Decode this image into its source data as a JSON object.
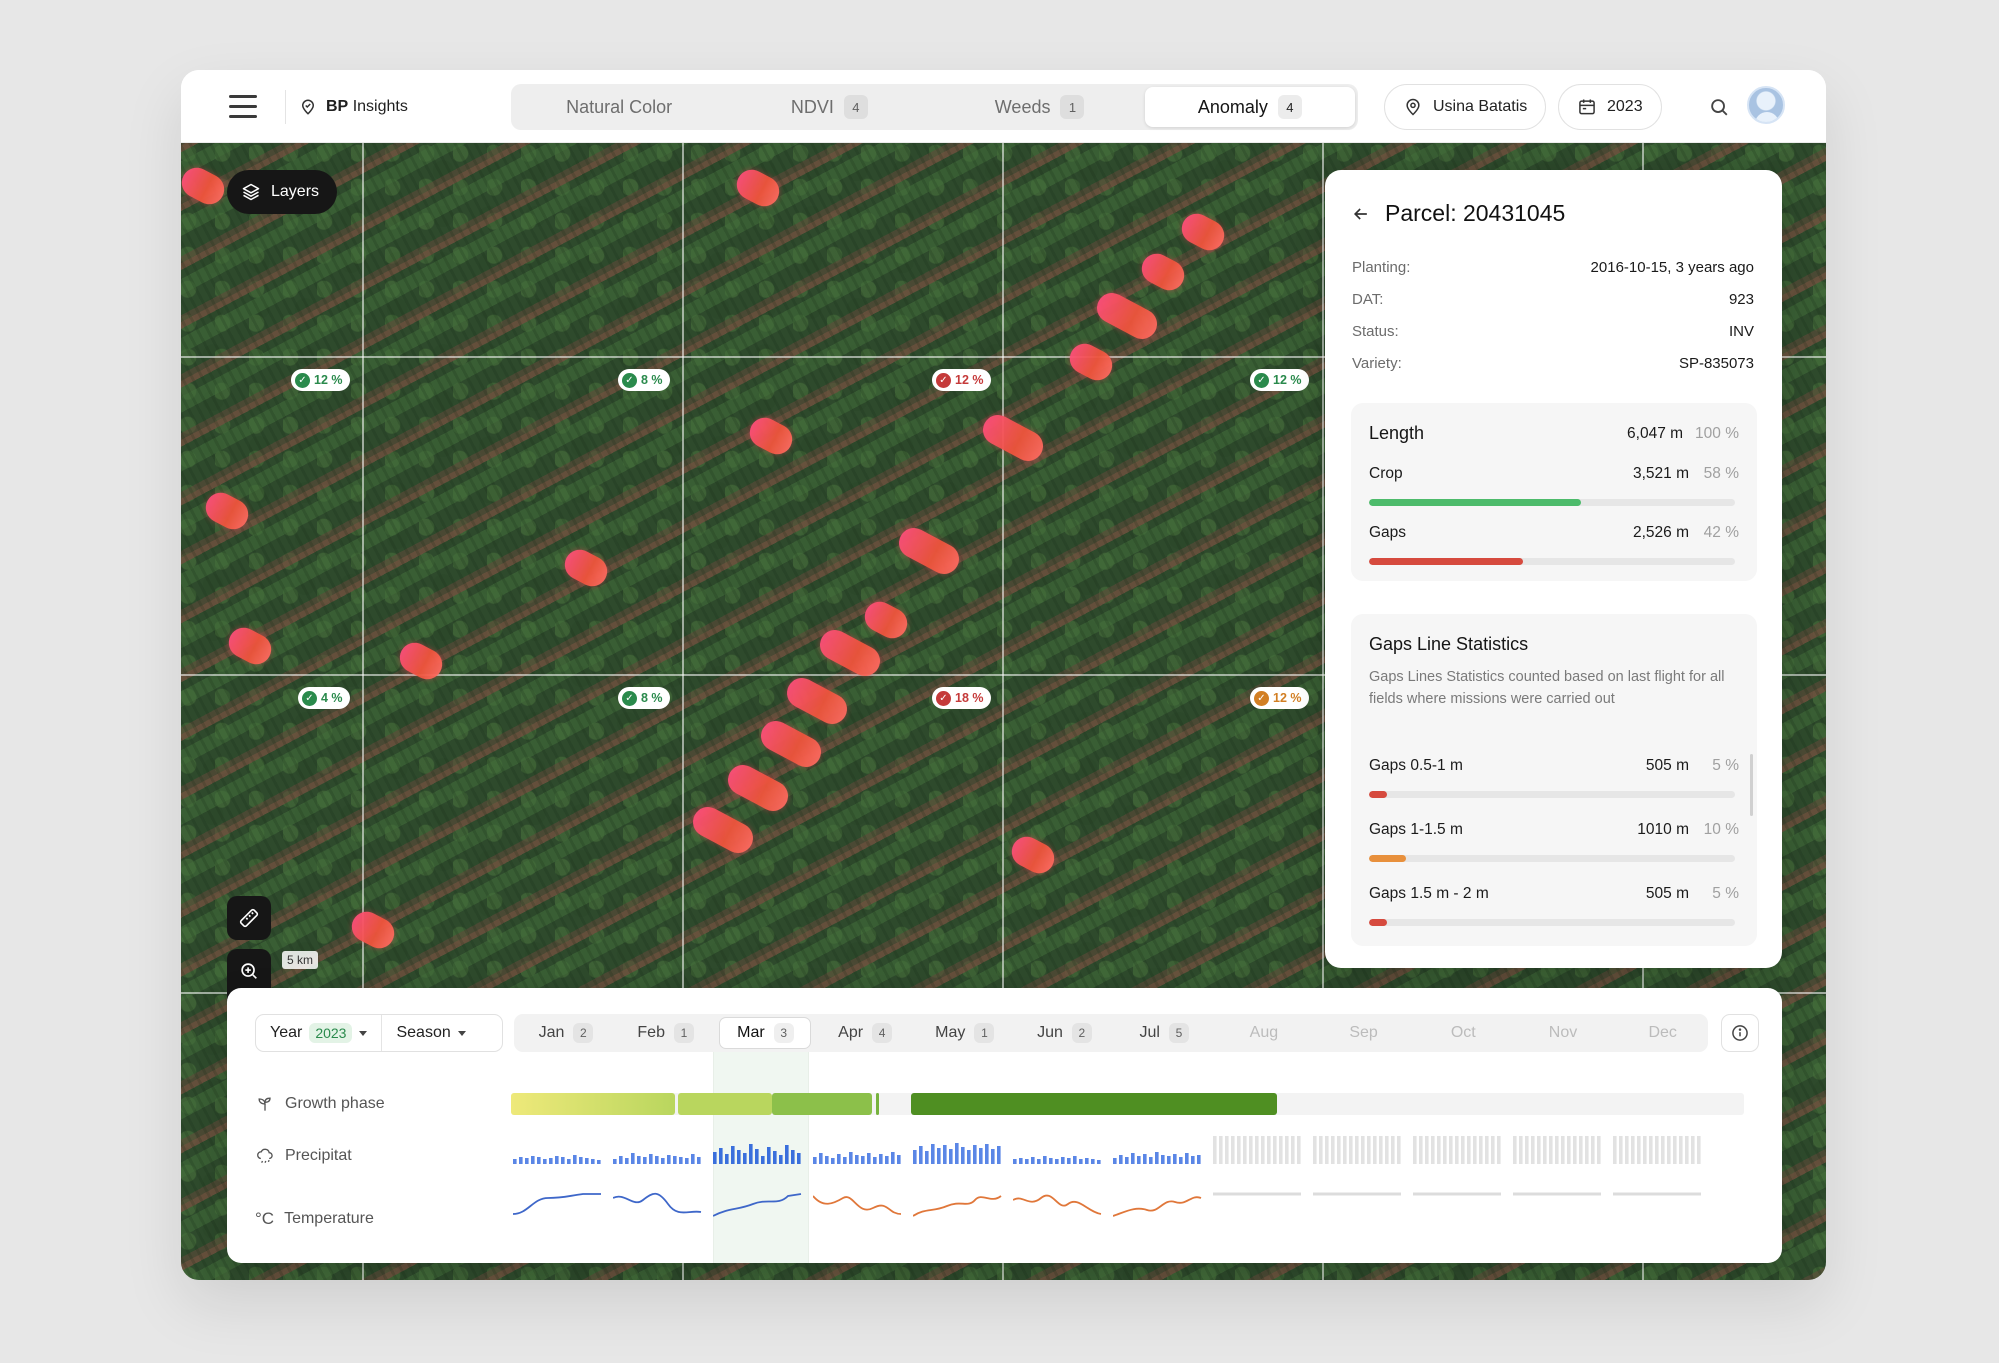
{
  "brand": {
    "name_bold": "BP",
    "name": "Insights"
  },
  "tabs": [
    {
      "label": "Natural Color",
      "count": ""
    },
    {
      "label": "NDVI",
      "count": "4"
    },
    {
      "label": "Weeds",
      "count": "1"
    },
    {
      "label": "Anomaly",
      "count": "4"
    }
  ],
  "active_tab": "Anomaly",
  "location": "Usina Batatis",
  "year_picker": "2023",
  "map": {
    "layers_label": "Layers",
    "scale_label": "5 km",
    "badges": [
      {
        "value": "12 %",
        "status": "green"
      },
      {
        "value": "8 %",
        "status": "green"
      },
      {
        "value": "12 %",
        "status": "red"
      },
      {
        "value": "12 %",
        "status": "green"
      },
      {
        "value": "4 %",
        "status": "green"
      },
      {
        "value": "8 %",
        "status": "green"
      },
      {
        "value": "18 %",
        "status": "red"
      },
      {
        "value": "12 %",
        "status": "orange"
      }
    ]
  },
  "parcel": {
    "title": "Parcel: 20431045",
    "fields": [
      {
        "key": "Planting:",
        "value": "2016-10-15, 3 years ago"
      },
      {
        "key": "DAT:",
        "value": "923"
      },
      {
        "key": "Status:",
        "value": "INV"
      },
      {
        "key": "Variety:",
        "value": "SP-835073"
      }
    ],
    "length": {
      "title": "Length",
      "total": "6,047 m",
      "total_pct": "100 %",
      "rows": [
        {
          "label": "Crop",
          "value": "3,521 m",
          "pct": "58 %",
          "fraction": 0.58,
          "color": "#4dbb6b"
        },
        {
          "label": "Gaps",
          "value": "2,526 m",
          "pct": "42 %",
          "fraction": 0.42,
          "color": "#d64a3e"
        }
      ]
    },
    "gaps_stats": {
      "title": "Gaps Line Statistics",
      "description": "Gaps Lines Statistics counted based on last flight for all fields where missions were carried out",
      "rows": [
        {
          "label": "Gaps 0.5-1 m",
          "value": "505 m",
          "pct": "5 %",
          "fraction": 0.05,
          "color": "#d64a3e"
        },
        {
          "label": "Gaps 1-1.5 m",
          "value": "1010 m",
          "pct": "10 %",
          "fraction": 0.1,
          "color": "#e8903c"
        },
        {
          "label": "Gaps 1.5 m - 2 m",
          "value": "505 m",
          "pct": "5 %",
          "fraction": 0.05,
          "color": "#d64a3e"
        }
      ]
    }
  },
  "timeline": {
    "year_label": "Year",
    "year_value": "2023",
    "season_label": "Season",
    "months": [
      {
        "label": "Jan",
        "count": "2"
      },
      {
        "label": "Feb",
        "count": "1"
      },
      {
        "label": "Mar",
        "count": "3"
      },
      {
        "label": "Apr",
        "count": "4"
      },
      {
        "label": "May",
        "count": "1"
      },
      {
        "label": "Jun",
        "count": "2"
      },
      {
        "label": "Jul",
        "count": "5"
      },
      {
        "label": "Aug",
        "count": ""
      },
      {
        "label": "Sep",
        "count": ""
      },
      {
        "label": "Oct",
        "count": ""
      },
      {
        "label": "Nov",
        "count": ""
      },
      {
        "label": "Dec",
        "count": ""
      }
    ],
    "active_month": "Mar",
    "rows": {
      "growth": "Growth phase",
      "precip": "Precipitat",
      "temp": "Temperature"
    },
    "growth_colors": [
      "#eee97a",
      "#b9d65e",
      "#8cc04a",
      "#76b23e",
      "#4f8f22"
    ]
  }
}
